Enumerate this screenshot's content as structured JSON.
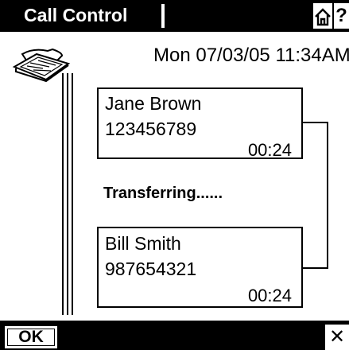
{
  "titlebar": {
    "title": "Call Control",
    "home_icon": "home-icon",
    "help_label": "?"
  },
  "header": {
    "datetime": "Mon 07/03/05 11:34AM",
    "phone_icon": "phone-icon"
  },
  "calls": [
    {
      "name": "Jane Brown",
      "number": "123456789",
      "duration": "00:24"
    },
    {
      "name": "Bill Smith",
      "number": "987654321",
      "duration": "00:24"
    }
  ],
  "status": "Transferring......",
  "softkeys": {
    "ok_label": "OK",
    "close_label": "✕"
  }
}
